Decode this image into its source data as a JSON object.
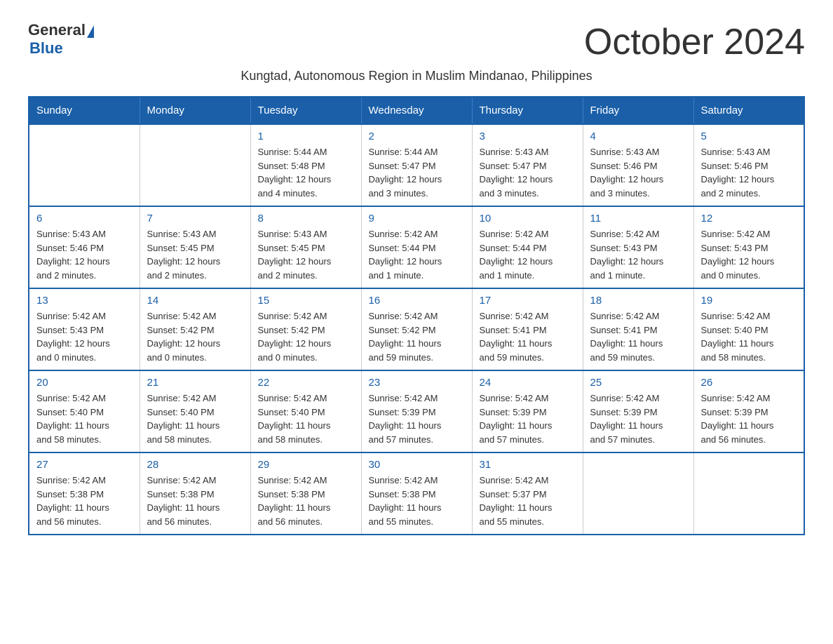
{
  "logo": {
    "general": "General",
    "blue": "Blue"
  },
  "title": "October 2024",
  "subtitle": "Kungtad, Autonomous Region in Muslim Mindanao, Philippines",
  "weekdays": [
    "Sunday",
    "Monday",
    "Tuesday",
    "Wednesday",
    "Thursday",
    "Friday",
    "Saturday"
  ],
  "weeks": [
    [
      {
        "day": "",
        "info": ""
      },
      {
        "day": "",
        "info": ""
      },
      {
        "day": "1",
        "info": "Sunrise: 5:44 AM\nSunset: 5:48 PM\nDaylight: 12 hours\nand 4 minutes."
      },
      {
        "day": "2",
        "info": "Sunrise: 5:44 AM\nSunset: 5:47 PM\nDaylight: 12 hours\nand 3 minutes."
      },
      {
        "day": "3",
        "info": "Sunrise: 5:43 AM\nSunset: 5:47 PM\nDaylight: 12 hours\nand 3 minutes."
      },
      {
        "day": "4",
        "info": "Sunrise: 5:43 AM\nSunset: 5:46 PM\nDaylight: 12 hours\nand 3 minutes."
      },
      {
        "day": "5",
        "info": "Sunrise: 5:43 AM\nSunset: 5:46 PM\nDaylight: 12 hours\nand 2 minutes."
      }
    ],
    [
      {
        "day": "6",
        "info": "Sunrise: 5:43 AM\nSunset: 5:46 PM\nDaylight: 12 hours\nand 2 minutes."
      },
      {
        "day": "7",
        "info": "Sunrise: 5:43 AM\nSunset: 5:45 PM\nDaylight: 12 hours\nand 2 minutes."
      },
      {
        "day": "8",
        "info": "Sunrise: 5:43 AM\nSunset: 5:45 PM\nDaylight: 12 hours\nand 2 minutes."
      },
      {
        "day": "9",
        "info": "Sunrise: 5:42 AM\nSunset: 5:44 PM\nDaylight: 12 hours\nand 1 minute."
      },
      {
        "day": "10",
        "info": "Sunrise: 5:42 AM\nSunset: 5:44 PM\nDaylight: 12 hours\nand 1 minute."
      },
      {
        "day": "11",
        "info": "Sunrise: 5:42 AM\nSunset: 5:43 PM\nDaylight: 12 hours\nand 1 minute."
      },
      {
        "day": "12",
        "info": "Sunrise: 5:42 AM\nSunset: 5:43 PM\nDaylight: 12 hours\nand 0 minutes."
      }
    ],
    [
      {
        "day": "13",
        "info": "Sunrise: 5:42 AM\nSunset: 5:43 PM\nDaylight: 12 hours\nand 0 minutes."
      },
      {
        "day": "14",
        "info": "Sunrise: 5:42 AM\nSunset: 5:42 PM\nDaylight: 12 hours\nand 0 minutes."
      },
      {
        "day": "15",
        "info": "Sunrise: 5:42 AM\nSunset: 5:42 PM\nDaylight: 12 hours\nand 0 minutes."
      },
      {
        "day": "16",
        "info": "Sunrise: 5:42 AM\nSunset: 5:42 PM\nDaylight: 11 hours\nand 59 minutes."
      },
      {
        "day": "17",
        "info": "Sunrise: 5:42 AM\nSunset: 5:41 PM\nDaylight: 11 hours\nand 59 minutes."
      },
      {
        "day": "18",
        "info": "Sunrise: 5:42 AM\nSunset: 5:41 PM\nDaylight: 11 hours\nand 59 minutes."
      },
      {
        "day": "19",
        "info": "Sunrise: 5:42 AM\nSunset: 5:40 PM\nDaylight: 11 hours\nand 58 minutes."
      }
    ],
    [
      {
        "day": "20",
        "info": "Sunrise: 5:42 AM\nSunset: 5:40 PM\nDaylight: 11 hours\nand 58 minutes."
      },
      {
        "day": "21",
        "info": "Sunrise: 5:42 AM\nSunset: 5:40 PM\nDaylight: 11 hours\nand 58 minutes."
      },
      {
        "day": "22",
        "info": "Sunrise: 5:42 AM\nSunset: 5:40 PM\nDaylight: 11 hours\nand 58 minutes."
      },
      {
        "day": "23",
        "info": "Sunrise: 5:42 AM\nSunset: 5:39 PM\nDaylight: 11 hours\nand 57 minutes."
      },
      {
        "day": "24",
        "info": "Sunrise: 5:42 AM\nSunset: 5:39 PM\nDaylight: 11 hours\nand 57 minutes."
      },
      {
        "day": "25",
        "info": "Sunrise: 5:42 AM\nSunset: 5:39 PM\nDaylight: 11 hours\nand 57 minutes."
      },
      {
        "day": "26",
        "info": "Sunrise: 5:42 AM\nSunset: 5:39 PM\nDaylight: 11 hours\nand 56 minutes."
      }
    ],
    [
      {
        "day": "27",
        "info": "Sunrise: 5:42 AM\nSunset: 5:38 PM\nDaylight: 11 hours\nand 56 minutes."
      },
      {
        "day": "28",
        "info": "Sunrise: 5:42 AM\nSunset: 5:38 PM\nDaylight: 11 hours\nand 56 minutes."
      },
      {
        "day": "29",
        "info": "Sunrise: 5:42 AM\nSunset: 5:38 PM\nDaylight: 11 hours\nand 56 minutes."
      },
      {
        "day": "30",
        "info": "Sunrise: 5:42 AM\nSunset: 5:38 PM\nDaylight: 11 hours\nand 55 minutes."
      },
      {
        "day": "31",
        "info": "Sunrise: 5:42 AM\nSunset: 5:37 PM\nDaylight: 11 hours\nand 55 minutes."
      },
      {
        "day": "",
        "info": ""
      },
      {
        "day": "",
        "info": ""
      }
    ]
  ]
}
